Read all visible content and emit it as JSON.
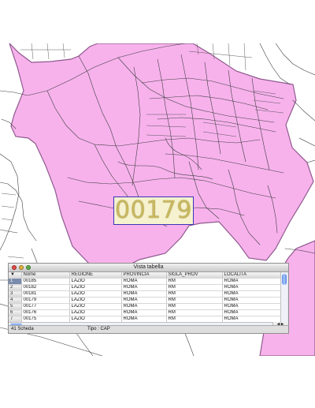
{
  "map": {
    "postal_code_label": "00179",
    "colors": {
      "zone_fill": "#f7b2ec",
      "zone_stroke": "#8f5a8e",
      "road": "#3f3f3f",
      "label_border": "#3a33b8",
      "label_fill": "#f6f2cf",
      "label_text": "#c9b85e"
    }
  },
  "table_window": {
    "title": "Vista tabella",
    "columns": [
      "Nome",
      "REGIONE",
      "PROVINCIA",
      "SIGLA_PROV",
      "LOCALITA"
    ],
    "rows": [
      {
        "num": "1",
        "nome": "00185",
        "regione": "LAZIO",
        "provincia": "ROMA",
        "sigla_prov": "RM",
        "localita": "ROMA"
      },
      {
        "num": "2",
        "nome": "00182",
        "regione": "LAZIO",
        "provincia": "ROMA",
        "sigla_prov": "RM",
        "localita": "ROMA"
      },
      {
        "num": "3",
        "nome": "00181",
        "regione": "LAZIO",
        "provincia": "ROMA",
        "sigla_prov": "RM",
        "localita": "ROMA"
      },
      {
        "num": "4",
        "nome": "00179",
        "regione": "LAZIO",
        "provincia": "ROMA",
        "sigla_prov": "RM",
        "localita": "ROMA"
      },
      {
        "num": "5",
        "nome": "00177",
        "regione": "LAZIO",
        "provincia": "ROMA",
        "sigla_prov": "RM",
        "localita": "ROMA"
      },
      {
        "num": "6",
        "nome": "00176",
        "regione": "LAZIO",
        "provincia": "ROMA",
        "sigla_prov": "RM",
        "localita": "ROMA"
      },
      {
        "num": "7",
        "nome": "00175",
        "regione": "LAZIO",
        "provincia": "ROMA",
        "sigla_prov": "RM",
        "localita": "ROMA"
      }
    ],
    "selected_row": "1",
    "status": {
      "count": "41 Scheda",
      "type": "Tipo : CAP"
    }
  }
}
